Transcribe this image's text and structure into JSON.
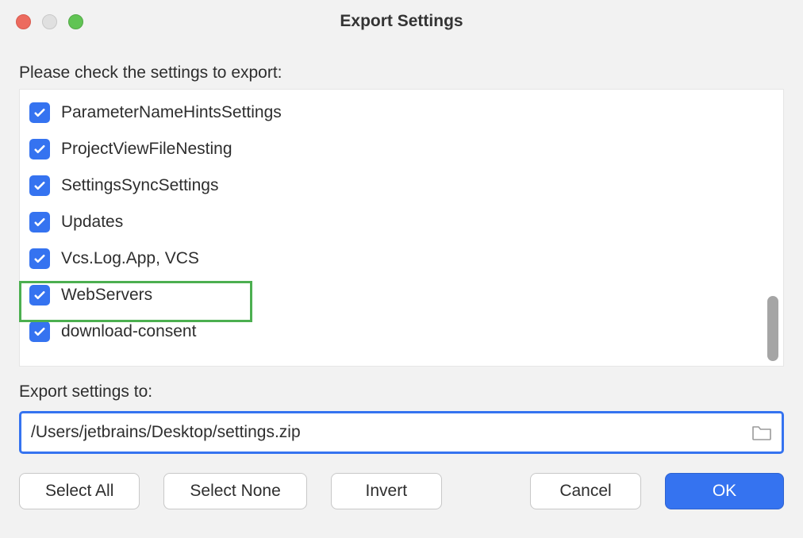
{
  "window": {
    "title": "Export Settings"
  },
  "instruction": "Please check the settings to export:",
  "settings_items": [
    {
      "label": "ParameterNameHintsSettings",
      "checked": true
    },
    {
      "label": "ProjectViewFileNesting",
      "checked": true
    },
    {
      "label": "SettingsSyncSettings",
      "checked": true
    },
    {
      "label": "Updates",
      "checked": true
    },
    {
      "label": "Vcs.Log.App, VCS",
      "checked": true
    },
    {
      "label": "WebServers",
      "checked": true
    },
    {
      "label": "download-consent",
      "checked": true
    }
  ],
  "export_to_label": "Export settings to:",
  "export_path": "/Users/jetbrains/Desktop/settings.zip",
  "buttons": {
    "select_all": "Select All",
    "select_none": "Select None",
    "invert": "Invert",
    "cancel": "Cancel",
    "ok": "OK"
  },
  "colors": {
    "accent": "#3573f0",
    "highlight": "#4caf50"
  }
}
